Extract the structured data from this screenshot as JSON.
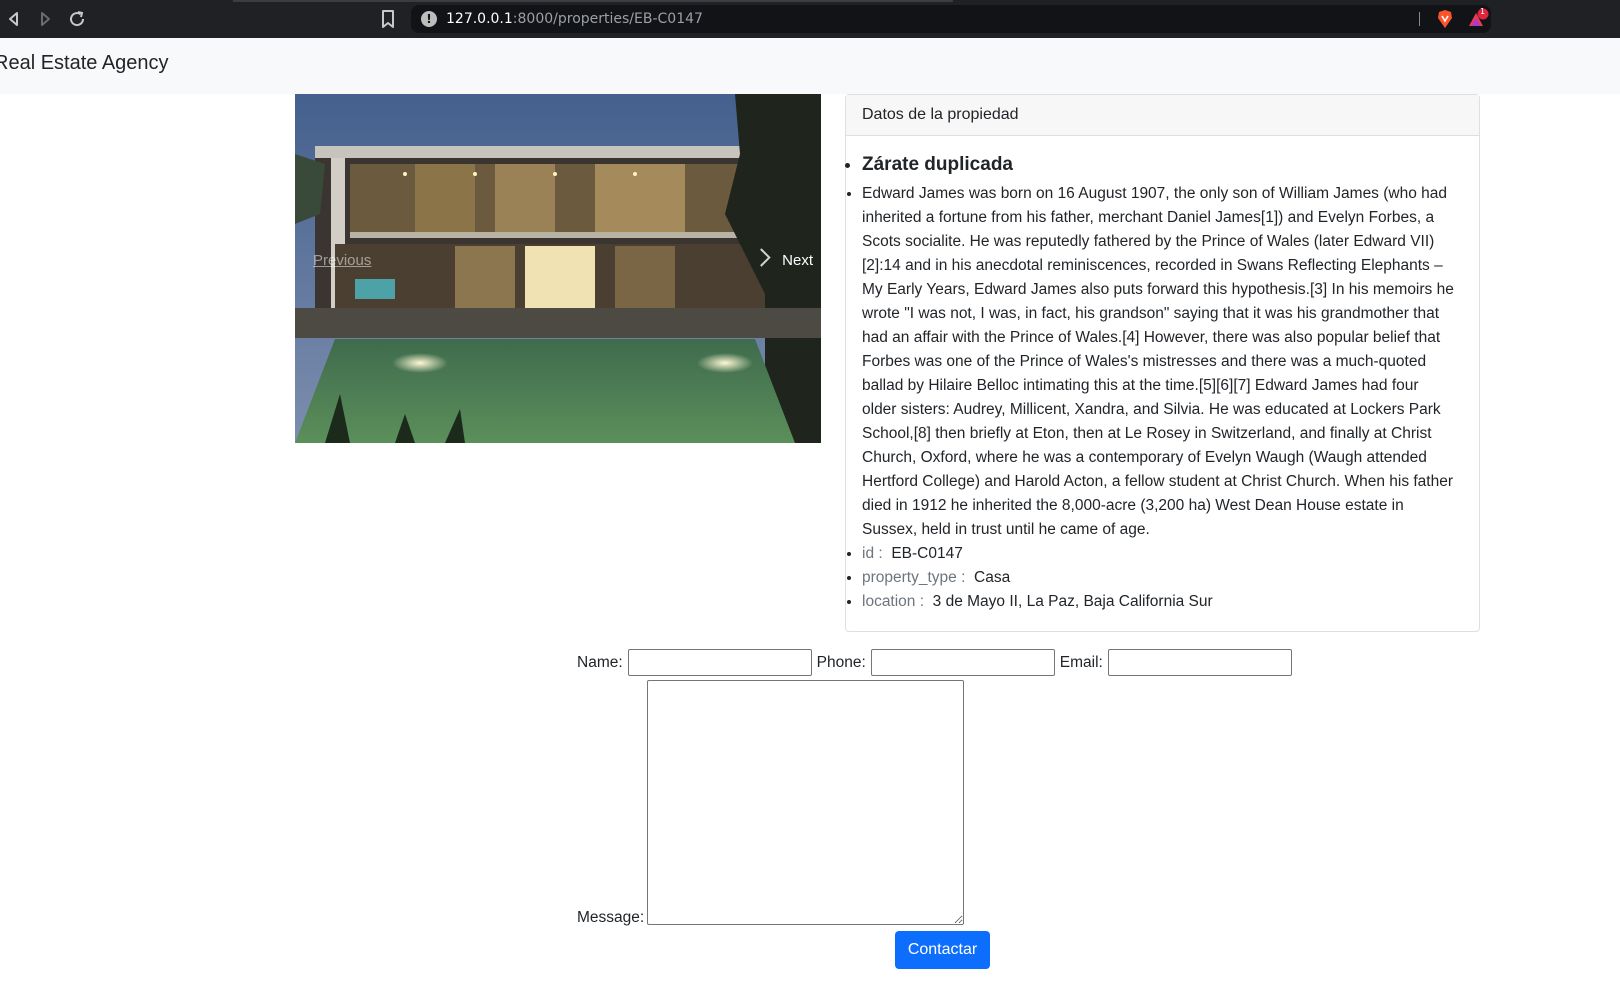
{
  "browser": {
    "back_icon": "back-arrow-icon",
    "forward_icon": "forward-arrow-icon",
    "reload_icon": "reload-icon",
    "url_host": "127.0.0.1",
    "url_path": ":8000/properties/EB-C0147",
    "rewards_badge": "1"
  },
  "navbar": {
    "brand": "Real Estate Agency"
  },
  "carousel": {
    "prev_label": "Previous",
    "next_label": "Next"
  },
  "card": {
    "header": "Datos de la propiedad",
    "title": "Zárate duplicada",
    "description": "Edward James was born on 16 August 1907, the only son of William James (who had inherited a fortune from his father, merchant Daniel James[1]) and Evelyn Forbes, a Scots socialite. He was reputedly fathered by the Prince of Wales (later Edward VII)[2]:14 and in his anecdotal reminiscences, recorded in Swans Reflecting Elephants – My Early Years, Edward James also puts forward this hypothesis.[3] In his memoirs he wrote \"I was not, I was, in fact, his grandson\" saying that it was his grandmother that had an affair with the Prince of Wales.[4] However, there was also popular belief that Forbes was one of the Prince of Wales's mistresses and there was a much-quoted ballad by Hilaire Belloc intimating this at the time.[5][6][7] Edward James had four older sisters: Audrey, Millicent, Xandra, and Silvia. He was educated at Lockers Park School,[8] then briefly at Eton, then at Le Rosey in Switzerland, and finally at Christ Church, Oxford, where he was a contemporary of Evelyn Waugh (Waugh attended Hertford College) and Harold Acton, a fellow student at Christ Church. When his father died in 1912 he inherited the 8,000-acre (3,200 ha) West Dean House estate in Sussex, held in trust until he came of age.",
    "attributes": [
      {
        "key": "id :",
        "value": "EB-C0147"
      },
      {
        "key": "property_type :",
        "value": "Casa"
      },
      {
        "key": "location :",
        "value": "3 de Mayo II, La Paz, Baja California Sur"
      }
    ]
  },
  "form": {
    "name_label": "Name:",
    "name_value": "",
    "phone_label": "Phone:",
    "phone_value": "",
    "email_label": "Email:",
    "email_value": "",
    "message_label": "Message:",
    "message_value": "",
    "submit_label": "Contactar"
  },
  "colors": {
    "primary_button": "#0d6efd",
    "navbar_bg": "#f8f9fa",
    "browser_bg": "#202124"
  }
}
